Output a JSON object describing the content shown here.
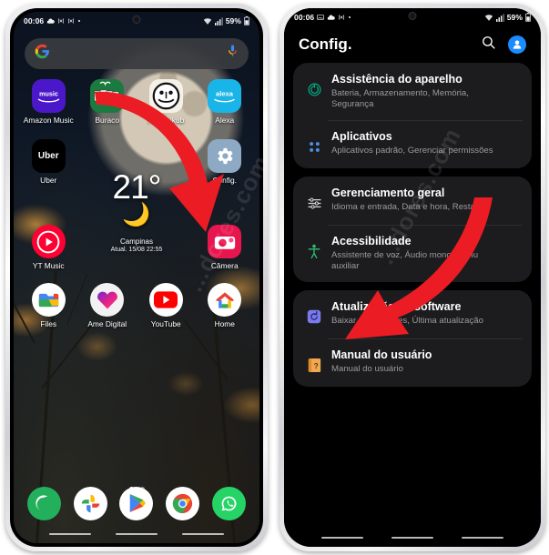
{
  "left_phone": {
    "statusbar": {
      "time": "00:06",
      "battery": "59%",
      "icons_left": [
        "cloud-icon",
        "music-note-icon",
        "music-note-icon",
        "dot-icon"
      ],
      "icons_right": [
        "wifi-icon",
        "signal-icon",
        "battery-icon"
      ]
    },
    "search": {
      "placeholder": "",
      "left_icon": "google-g-icon",
      "right_icon": "microphone-icon"
    },
    "apps": [
      [
        {
          "label": "Amazon Music",
          "icon": "amazon-music-icon",
          "bg": "#4b18c9"
        },
        {
          "label": "Buraco",
          "icon": "buraco-cards-icon",
          "bg": "#1a7a40"
        },
        {
          "label": "Rummikub",
          "icon": "rummikub-face-icon",
          "bg": "#f3f1e8"
        },
        {
          "label": "Alexa",
          "icon": "alexa-icon",
          "bg": "#19b5e8"
        }
      ],
      [
        {
          "label": "Uber",
          "icon": "uber-icon",
          "bg": "#000000"
        },
        {
          "label": "",
          "icon": "",
          "bg": ""
        },
        {
          "label": "",
          "icon": "",
          "bg": ""
        },
        {
          "label": "Config.",
          "icon": "gear-icon",
          "bg": "#8da9c4"
        }
      ],
      [
        {
          "label": "YT Music",
          "icon": "youtube-music-icon",
          "bg": "#ff0033"
        },
        {
          "label": "",
          "icon": "",
          "bg": ""
        },
        {
          "label": "",
          "icon": "",
          "bg": ""
        },
        {
          "label": "Câmera",
          "icon": "camera-icon",
          "bg": "#e8164f"
        }
      ],
      [
        {
          "label": "Files",
          "icon": "files-icon",
          "bg": "#ffffff"
        },
        {
          "label": "Ame Digital",
          "icon": "ame-heart-icon",
          "bg": "#f2f2f2"
        },
        {
          "label": "YouTube",
          "icon": "youtube-icon",
          "bg": "#ffffff"
        },
        {
          "label": "Home",
          "icon": "google-home-icon",
          "bg": "#ffffff"
        }
      ]
    ],
    "weather": {
      "temperature": "21°",
      "condition_icon": "crescent-moon-icon",
      "location_icon": "location-off-icon",
      "city": "Campinas",
      "updated": "Atual. 15/08 22:55",
      "refresh_icon": "refresh-icon"
    },
    "pagination": {
      "pages": 2,
      "active": 1
    },
    "dock": [
      {
        "label": "Phone",
        "icon": "phone-icon",
        "bg": "#22b05c"
      },
      {
        "label": "Google Photos",
        "icon": "google-photos-icon",
        "bg": "#ffffff"
      },
      {
        "label": "Play Store",
        "icon": "play-store-icon",
        "bg": "#ffffff"
      },
      {
        "label": "Chrome",
        "icon": "chrome-icon",
        "bg": "#ffffff"
      },
      {
        "label": "WhatsApp",
        "icon": "whatsapp-icon",
        "bg": "#25d366"
      }
    ]
  },
  "right_phone": {
    "statusbar": {
      "time": "00:06",
      "battery": "59%",
      "icons_left": [
        "image-icon",
        "cloud-icon",
        "music-note-icon",
        "dot-icon"
      ],
      "icons_right": [
        "wifi-icon",
        "signal-icon",
        "battery-icon"
      ]
    },
    "header": {
      "title": "Config.",
      "search_icon": "search-icon",
      "account_icon": "account-avatar-icon"
    },
    "groups": [
      {
        "items": [
          {
            "title": "Assistência do aparelho",
            "subtitle": "Bateria, Armazenamento, Memória, Segurança",
            "icon": "device-care-icon",
            "icon_color": "#00b089"
          },
          {
            "title": "Aplicativos",
            "subtitle": "Aplicativos padrão, Gerenciar permissões",
            "icon": "apps-grid-icon",
            "icon_color": "#4a90e2"
          }
        ]
      },
      {
        "items": [
          {
            "title": "Gerenciamento geral",
            "subtitle": "Idioma e entrada, Data e hora, Restaurar",
            "icon": "sliders-icon",
            "icon_color": "#d8d8da"
          },
          {
            "title": "Acessibilidade",
            "subtitle": "Assistente de voz, Áudio mono, Menu auxiliar",
            "icon": "accessibility-icon",
            "icon_color": "#2fbf71"
          }
        ]
      },
      {
        "items": [
          {
            "title": "Atualização de software",
            "subtitle": "Baixar atualizações, Última atualização",
            "icon": "software-update-icon",
            "icon_color": "#7b7bf0"
          },
          {
            "title": "Manual do usuário",
            "subtitle": "Manual do usuário",
            "icon": "user-manual-icon",
            "icon_color": "#f0a952"
          }
        ]
      }
    ]
  },
  "annotations": {
    "arrow_color": "#ec1c24",
    "arrow_left_target": "Config.",
    "arrow_right_target": "Gerenciamento geral"
  },
  "watermark": {
    "text": "...dores.com"
  }
}
